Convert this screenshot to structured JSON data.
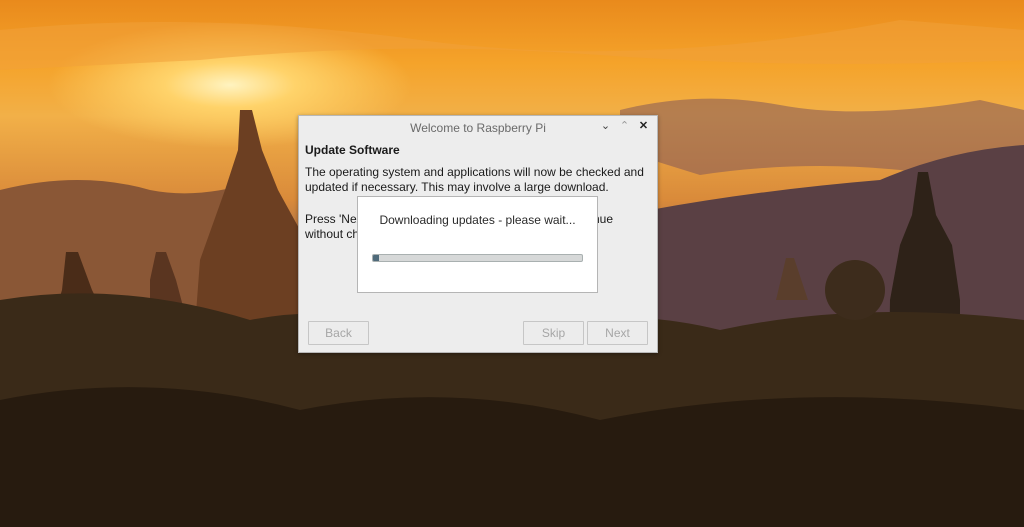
{
  "window": {
    "title": "Welcome to Raspberry Pi",
    "controls": [
      "chevron-down-icon",
      "chevron-up-icon",
      "close-icon"
    ],
    "heading": "Update Software",
    "body_paragraph_1": "The operating system and applications will now be checked and updated if necessary. This may involve a large download.",
    "body_paragraph_2_visible_start": "Press 'Next",
    "body_paragraph_2_visible_end": "nue",
    "body_paragraph_2_line2_start": "without ch",
    "buttons": {
      "back": "Back",
      "skip": "Skip",
      "next": "Next"
    }
  },
  "progress_dialog": {
    "message": "Downloading updates - please wait...",
    "progress": 0.03
  },
  "colors": {
    "dialog_bg": "#ededed",
    "popup_bg": "#ffffff",
    "progress_fill": "#4f6a7a",
    "disabled_text": "#a6a6a6"
  }
}
